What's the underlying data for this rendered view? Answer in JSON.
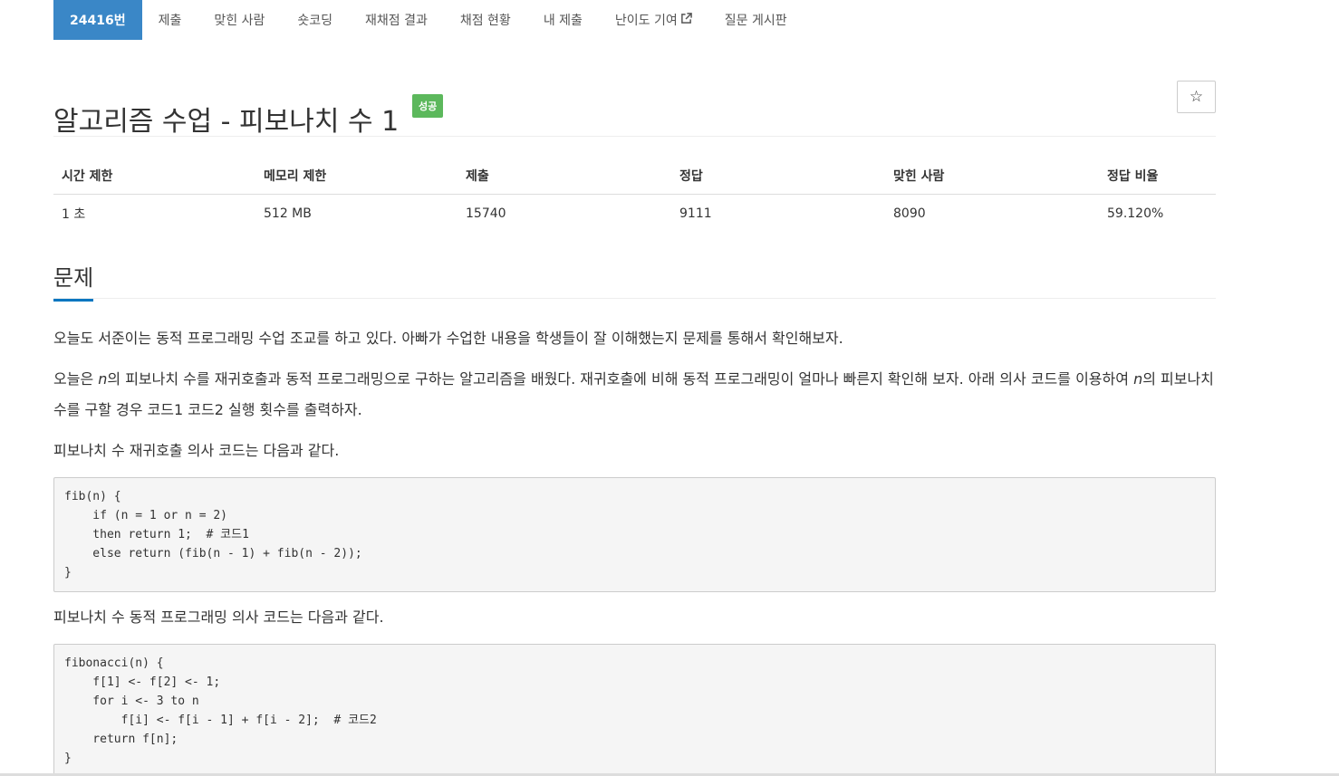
{
  "tabs": [
    {
      "label": "24416번",
      "active": true
    },
    {
      "label": "제출"
    },
    {
      "label": "맞힌 사람"
    },
    {
      "label": "숏코딩"
    },
    {
      "label": "재채점 결과"
    },
    {
      "label": "채점 현황"
    },
    {
      "label": "내 제출"
    },
    {
      "label": "난이도 기여",
      "icon": "external-link-icon"
    },
    {
      "label": "질문 게시판"
    }
  ],
  "problem": {
    "title": "알고리즘 수업 - 피보나치 수 1",
    "badge": "성공",
    "star": "☆"
  },
  "info_table": {
    "headers": [
      "시간 제한",
      "메모리 제한",
      "제출",
      "정답",
      "맞힌 사람",
      "정답 비율"
    ],
    "row": [
      "1 초",
      "512 MB",
      "15740",
      "9111",
      "8090",
      "59.120%"
    ]
  },
  "section": {
    "title": "문제"
  },
  "description": {
    "p1": "오늘도 서준이는 동적 프로그래밍 수업 조교를 하고 있다. 아빠가 수업한 내용을 학생들이 잘 이해했는지 문제를 통해서 확인해보자.",
    "p2_a": "오늘은 ",
    "p2_n1": "n",
    "p2_b": "의 피보나치 수를 재귀호출과 동적 프로그래밍으로 구하는 알고리즘을 배웠다. 재귀호출에 비해 동적 프로그래밍이 얼마나 빠른지 확인해 보자. 아래 의사 코드를 이용하여 ",
    "p2_n2": "n",
    "p2_c": "의 피보나치 수를 구할 경우 코드1 코드2 실행 횟수를 출력하자.",
    "p3": "피보나치 수 재귀호출 의사 코드는 다음과 같다.",
    "p4": "피보나치 수 동적 프로그래밍 의사 코드는 다음과 같다."
  },
  "code": {
    "recursive": "fib(n) {\n    if (n = 1 or n = 2)\n    then return 1;  # 코드1\n    else return (fib(n - 1) + fib(n - 2));\n}",
    "dynamic": "fibonacci(n) {\n    f[1] <- f[2] <- 1;\n    for i <- 3 to n\n        f[i] <- f[i - 1] + f[i - 2];  # 코드2\n    return f[n];\n}"
  },
  "colors": {
    "active_tab": "#3a87c7",
    "badge_success": "#5cb85c",
    "section_underline": "#0076c0"
  }
}
